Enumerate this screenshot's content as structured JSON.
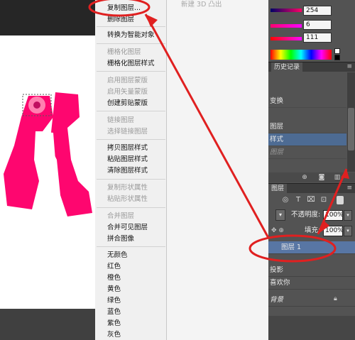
{
  "menu": {
    "groups": [
      [
        "复制图层...",
        "删除图层"
      ],
      [
        "转换为智能对象"
      ],
      [
        "栅格化图层",
        "栅格化图层样式"
      ],
      [
        "启用图层蒙版",
        "启用矢量蒙版",
        "创建剪贴蒙版"
      ],
      [
        "链接图层",
        "选择链接图层"
      ],
      [
        "拷贝图层样式",
        "粘贴图层样式",
        "清除图层样式"
      ],
      [
        "复制形状属性",
        "粘贴形状属性"
      ],
      [
        "合并图层",
        "合并可见图层",
        "拼合图像"
      ],
      [
        "无颜色",
        "红色",
        "橙色",
        "黄色",
        "绿色",
        "蓝色",
        "紫色",
        "灰色"
      ]
    ],
    "disabled": [
      "栅格化图层",
      "启用图层蒙版",
      "启用矢量蒙版",
      "链接图层",
      "选择链接图层",
      "复制形状属性",
      "粘贴形状属性",
      "合并图层"
    ],
    "item_0_0": "复制图层...",
    "item_0_1": "删除图层",
    "item_1_0": "转换为智能对象",
    "item_2_0": "栅格化图层",
    "item_2_1": "栅格化图层样式",
    "item_3_0": "启用图层蒙版",
    "item_3_1": "启用矢量蒙版",
    "item_3_2": "创建剪贴蒙版",
    "item_4_0": "链接图层",
    "item_4_1": "选择链接图层",
    "item_5_0": "拷贝图层样式",
    "item_5_1": "粘贴图层样式",
    "item_5_2": "清除图层样式",
    "item_6_0": "复制形状属性",
    "item_6_1": "粘贴形状属性",
    "item_7_0": "合并图层",
    "item_7_1": "合并可见图层",
    "item_7_2": "拼合图像",
    "color_none": "无颜色",
    "color_red": "红色",
    "color_orange": "橙色",
    "color_yellow": "黄色",
    "color_green": "绿色",
    "color_blue": "蓝色",
    "color_purple": "紫色",
    "color_gray": "灰色"
  },
  "faded_menu_text": "新建 3D 凸出",
  "color_panel": {
    "r": "254",
    "g": "6",
    "b": "111"
  },
  "history": {
    "tab": "历史记录",
    "rows": [
      "变换",
      "图层",
      "样式",
      "图层"
    ],
    "selected_index": 2
  },
  "layers": {
    "tab": "图层",
    "opacity_label": "不透明度:",
    "opacity_value": "100%",
    "lock_label": "锁定:",
    "fill_label": "填充:",
    "fill_value": "100%",
    "rows": {
      "layer1": "图层 1",
      "shadow": "投影",
      "text_layer": "喜欢你",
      "background": "背景"
    }
  },
  "colors": {
    "accent_pink": "#fe066f",
    "annotation_red": "#e02020",
    "selection_blue": "#5876a4"
  }
}
